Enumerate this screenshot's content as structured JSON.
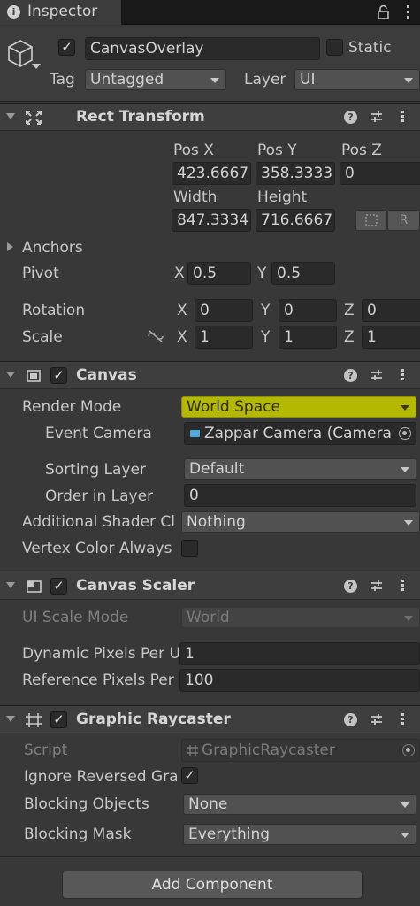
{
  "tab": {
    "title": "Inspector",
    "info_icon": "i"
  },
  "header": {
    "object_name": "CanvasOverlay",
    "static_label": "Static",
    "tag_label": "Tag",
    "tag_value": "Untagged",
    "layer_label": "Layer",
    "layer_value": "UI"
  },
  "rect_transform": {
    "title": "Rect Transform",
    "pos_x_label": "Pos X",
    "pos_y_label": "Pos Y",
    "pos_z_label": "Pos Z",
    "pos_x": "423.6667",
    "pos_y": "358.3333",
    "pos_z": "0",
    "width_label": "Width",
    "height_label": "Height",
    "width": "847.3334",
    "height": "716.6667",
    "r_button": "R",
    "anchors_label": "Anchors",
    "pivot_label": "Pivot",
    "pivot_x": "0.5",
    "pivot_y": "0.5",
    "rotation_label": "Rotation",
    "rot_x": "0",
    "rot_y": "0",
    "rot_z": "0",
    "scale_label": "Scale",
    "scale_x": "1",
    "scale_y": "1",
    "scale_z": "1",
    "x": "X",
    "y": "Y",
    "z": "Z"
  },
  "canvas": {
    "title": "Canvas",
    "render_mode_label": "Render Mode",
    "render_mode_value": "World Space",
    "event_camera_label": "Event Camera",
    "event_camera_value": "Zappar Camera (Camera",
    "sorting_layer_label": "Sorting Layer",
    "sorting_layer_value": "Default",
    "order_label": "Order in Layer",
    "order_value": "0",
    "shader_label": "Additional Shader Cl",
    "shader_value": "Nothing",
    "vertex_label": "Vertex Color Always"
  },
  "canvas_scaler": {
    "title": "Canvas Scaler",
    "ui_scale_label": "UI Scale Mode",
    "ui_scale_value": "World",
    "dynamic_label": "Dynamic Pixels Per U",
    "dynamic_value": "1",
    "reference_label": "Reference Pixels Per",
    "reference_value": "100"
  },
  "graphic_raycaster": {
    "title": "Graphic Raycaster",
    "script_label": "Script",
    "script_value": "GraphicRaycaster",
    "ignore_label": "Ignore Reversed Gra",
    "blocking_objects_label": "Blocking Objects",
    "blocking_objects_value": "None",
    "blocking_mask_label": "Blocking Mask",
    "blocking_mask_value": "Everything"
  },
  "add_component": "Add Component",
  "colors": {
    "highlight": "#b5b800",
    "background": "#383838",
    "field": "#2a2a2a",
    "dropdown": "#515151"
  }
}
